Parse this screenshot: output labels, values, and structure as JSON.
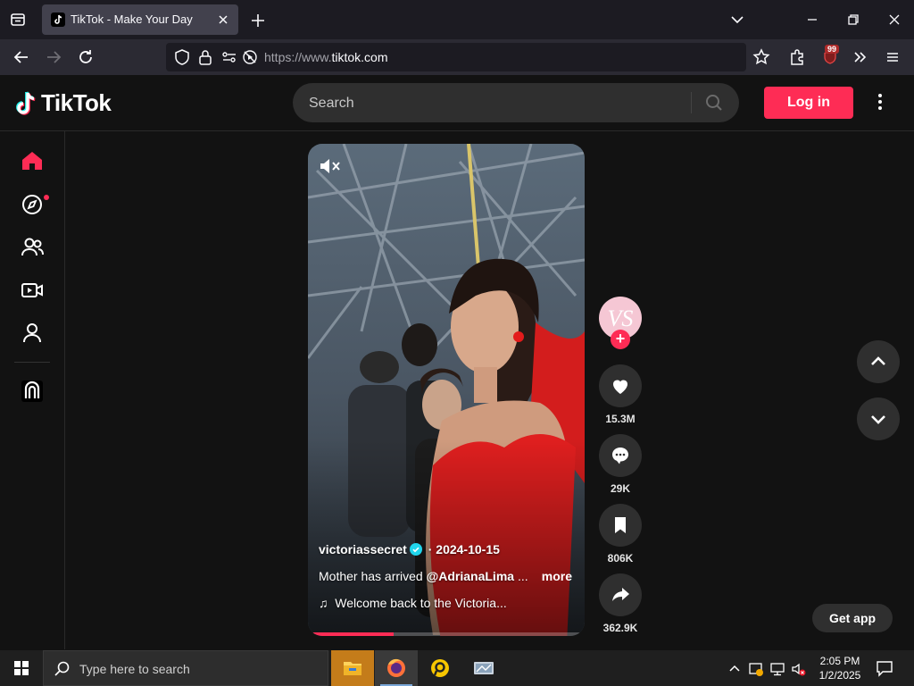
{
  "browser": {
    "tab_title": "TikTok - Make Your Day",
    "url_prefix": "https://www.",
    "url_domain": "tiktok.com",
    "extension_badge": "99"
  },
  "header": {
    "logo_text": "TikTok",
    "search_placeholder": "Search",
    "login_label": "Log in"
  },
  "video": {
    "username": "victoriassecret",
    "date": " · 2024-10-15",
    "description_text": "Mother has arrived ",
    "mention": "@AdrianaLima",
    "ellipsis": " ...",
    "more_label": "more",
    "music": "Welcome back to the Victoria...",
    "progress": 0.31
  },
  "actions": {
    "likes": "15.3M",
    "comments": "29K",
    "saves": "806K",
    "shares": "362.9K"
  },
  "get_app_label": "Get app",
  "taskbar": {
    "search_placeholder": "Type here to search",
    "time": "2:05 PM",
    "date": "1/2/2025"
  },
  "colors": {
    "brand": "#fe2c55",
    "background": "#121212",
    "surface": "#2f2f2f"
  }
}
